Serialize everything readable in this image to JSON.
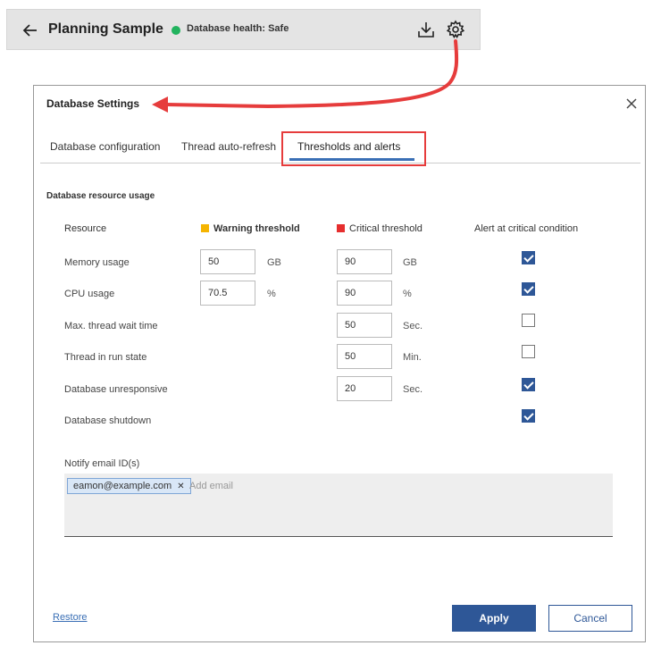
{
  "header": {
    "title": "Planning Sample",
    "health_text": "Database health: Safe",
    "health_color": "#22b35e",
    "icons": [
      "back-arrow-icon",
      "download-icon",
      "gear-icon"
    ]
  },
  "dialog": {
    "title": "Database Settings",
    "tabs": [
      {
        "label": "Database configuration",
        "active": false
      },
      {
        "label": "Thread auto-refresh",
        "active": false
      },
      {
        "label": "Thresholds and alerts",
        "active": true
      }
    ],
    "section_title": "Database resource usage",
    "columns": {
      "resource": "Resource",
      "warning": "Warning threshold",
      "critical": "Critical threshold",
      "alert": "Alert at critical condition"
    },
    "warning_color": "#f5b400",
    "critical_color": "#e62e2e",
    "rows": [
      {
        "label": "Memory usage",
        "warning": "50",
        "warning_unit": "GB",
        "critical": "90",
        "critical_unit": "GB",
        "alert": true
      },
      {
        "label": "CPU usage",
        "warning": "70.5",
        "warning_unit": "%",
        "critical": "90",
        "critical_unit": "%",
        "alert": true
      },
      {
        "label": "Max. thread wait time",
        "critical": "50",
        "critical_unit": "Sec.",
        "alert": false
      },
      {
        "label": "Thread in run state",
        "critical": "50",
        "critical_unit": "Min.",
        "alert": false
      },
      {
        "label": "Database unresponsive",
        "critical": "20",
        "critical_unit": "Sec.",
        "alert": true
      },
      {
        "label": "Database shutdown",
        "alert": true
      }
    ],
    "notify": {
      "label": "Notify email ID(s)",
      "emails": [
        "eamon@example.com"
      ],
      "placeholder": "Add email"
    },
    "footer": {
      "restore": "Restore",
      "apply": "Apply",
      "cancel": "Cancel"
    }
  },
  "annotation_color": "#e63c3c"
}
